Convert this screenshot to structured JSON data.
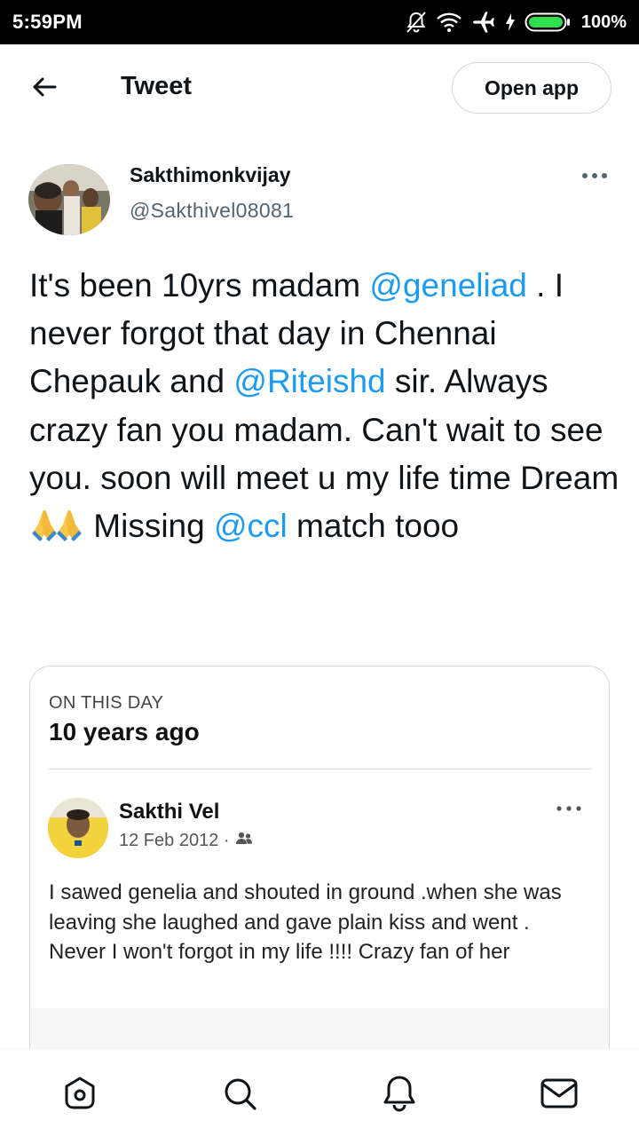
{
  "status_bar": {
    "time": "5:59PM",
    "battery": "100%",
    "icons": [
      "notifications-off-icon",
      "wifi-icon",
      "airplane-icon",
      "charging-icon",
      "battery-icon"
    ]
  },
  "nav": {
    "title": "Tweet",
    "open_app": "Open app",
    "back_icon": "arrow-left-icon"
  },
  "author": {
    "name": "Sakthimonkvijay",
    "handle": "@Sakthivel08081"
  },
  "tweet": {
    "segments": [
      {
        "text": "It's been 10yrs madam ",
        "type": "text"
      },
      {
        "text": "@geneliad",
        "type": "mention"
      },
      {
        "text": " . I never forgot that day in Chennai Chepauk and ",
        "type": "text"
      },
      {
        "text": "@Riteishd",
        "type": "mention"
      },
      {
        "text": " sir.  Always crazy fan you madam. Can't wait to see you. soon will meet u my life time Dream ",
        "type": "text"
      },
      {
        "text": " Missing ",
        "type": "text"
      },
      {
        "text": "@ccl",
        "type": "mention"
      },
      {
        "text": " match tooo",
        "type": "text"
      }
    ]
  },
  "card": {
    "label": "ON THIS DAY",
    "title": "10 years ago",
    "post": {
      "name": "Sakthi Vel",
      "date": "12 Feb 2012 ·",
      "text": "I sawed genelia and shouted in ground .when she was leaving she laughed and gave plain kiss and went . Never I won't forgot in my life !!!! Crazy fan of her"
    }
  },
  "bottom_nav": {
    "items": [
      "home-icon",
      "search-icon",
      "notifications-icon",
      "messages-icon"
    ]
  },
  "colors": {
    "accent": "#1d9bf0",
    "text": "#0f1419",
    "secondary": "#536471",
    "border": "#cfd9de"
  }
}
